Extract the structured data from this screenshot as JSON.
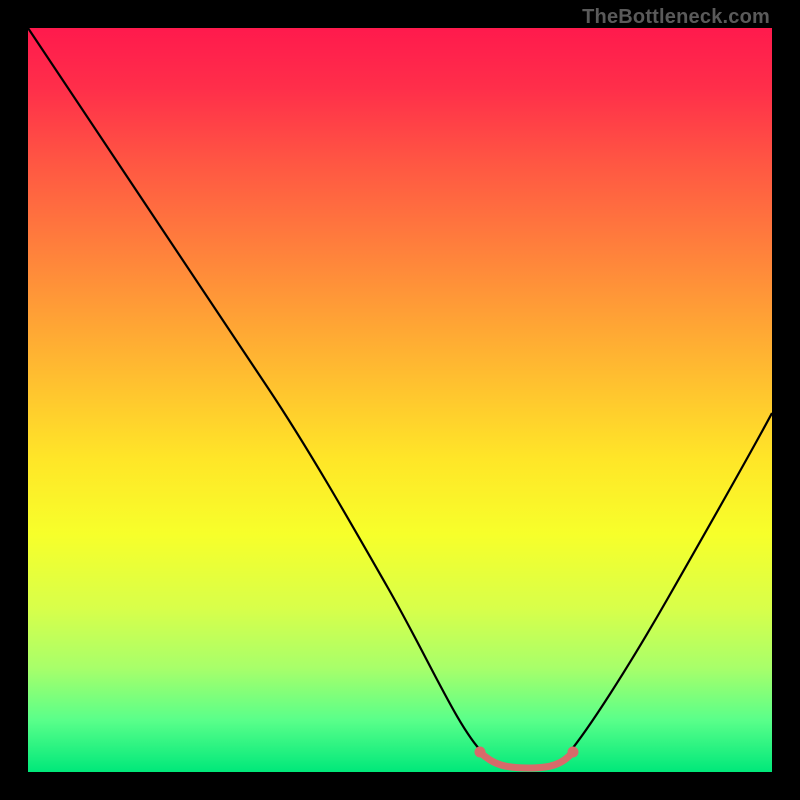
{
  "watermark": "TheBottleneck.com",
  "chart_data": {
    "type": "line",
    "title": "",
    "xlabel": "",
    "ylabel": "",
    "xlim": [
      0,
      100
    ],
    "ylim": [
      0,
      100
    ],
    "series": [
      {
        "name": "bottleneck-curve",
        "x": [
          0,
          5,
          10,
          15,
          20,
          25,
          30,
          35,
          40,
          45,
          50,
          55,
          60,
          62,
          65,
          68,
          70,
          72,
          75,
          80,
          85,
          90,
          95,
          100
        ],
        "values": [
          100,
          93,
          86,
          79,
          72,
          65,
          57,
          49,
          41,
          33,
          25,
          17,
          8,
          3,
          1,
          1,
          1,
          2,
          5,
          13,
          23,
          33,
          43,
          53
        ]
      }
    ],
    "markers": [
      {
        "name": "flat-region-start",
        "x": 61,
        "y": 3,
        "color": "#d86a6a"
      },
      {
        "name": "flat-region-end",
        "x": 73,
        "y": 3,
        "color": "#d86a6a"
      }
    ],
    "gradient_stops": [
      {
        "pos": 0,
        "color": "#ff1a4d"
      },
      {
        "pos": 50,
        "color": "#ffe628"
      },
      {
        "pos": 100,
        "color": "#00e87a"
      }
    ]
  }
}
